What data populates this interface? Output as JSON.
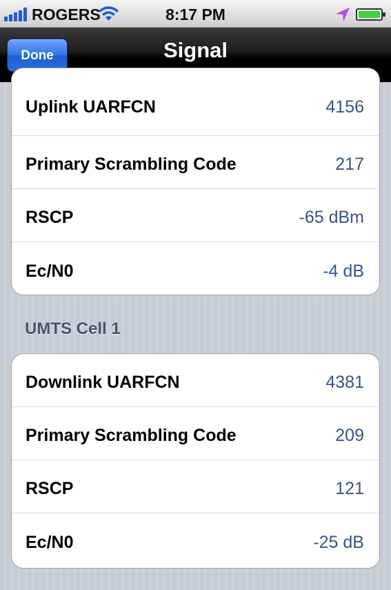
{
  "status_bar": {
    "carrier": "ROGERS",
    "time": "8:17 PM",
    "icons": [
      "signal-bars-icon",
      "wifi-icon",
      "location-arrow-icon",
      "battery-icon"
    ]
  },
  "nav_bar": {
    "done_label": "Done",
    "title": "Signal"
  },
  "group1": {
    "rows": [
      {
        "label": "Uplink UARFCN",
        "value": "4156"
      },
      {
        "label": "Primary Scrambling Code",
        "value": "217"
      },
      {
        "label": "RSCP",
        "value": "-65 dBm"
      },
      {
        "label": "Ec/N0",
        "value": "-4 dB"
      }
    ]
  },
  "section2": {
    "header": "UMTS Cell 1",
    "rows": [
      {
        "label": "Downlink UARFCN",
        "value": "4381"
      },
      {
        "label": "Primary Scrambling Code",
        "value": "209"
      },
      {
        "label": "RSCP",
        "value": "121"
      },
      {
        "label": "Ec/N0",
        "value": "-25 dB"
      }
    ]
  },
  "colors": {
    "accent_blue": "#2f73e0",
    "value_text": "#385487",
    "location_icon": "#b44de0",
    "battery_fill": "#3dd43d"
  }
}
